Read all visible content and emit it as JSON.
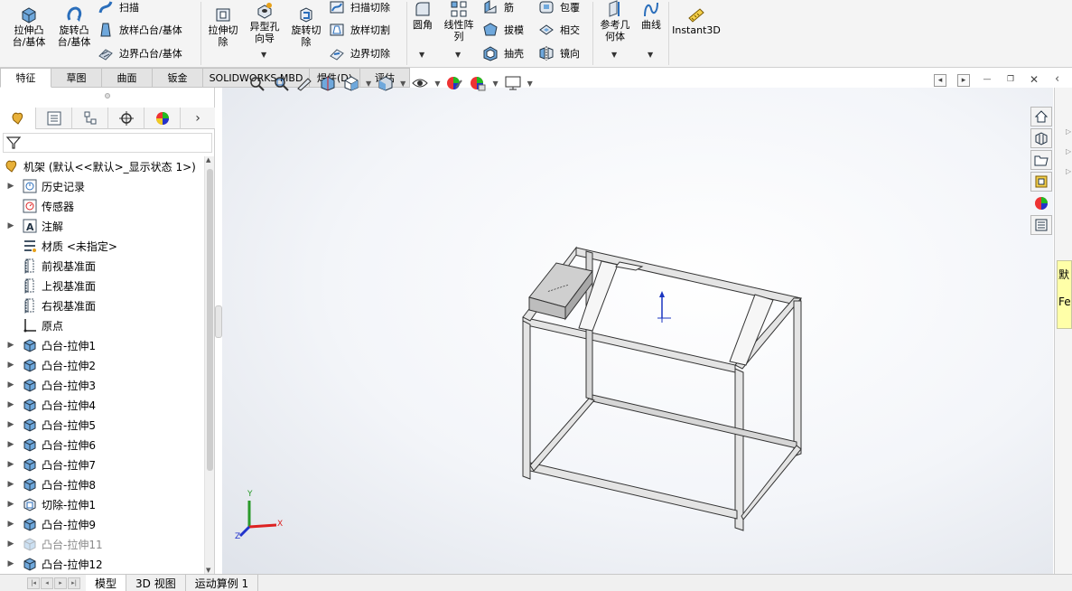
{
  "ribbon": {
    "extrude_boss": "拉伸凸\n台/基体",
    "revolve_boss": "旋转凸\n台/基体",
    "sweep": "扫描",
    "loft_boss": "放样凸台/基体",
    "boundary_boss": "边界凸台/基体",
    "extrude_cut": "拉伸切\n除",
    "hole_wizard": "异型孔\n向导",
    "revolve_cut": "旋转切\n除",
    "sweep_cut": "扫描切除",
    "loft_cut": "放样切割",
    "boundary_cut": "边界切除",
    "fillet": "圆角",
    "linear_pattern": "线性阵\n列",
    "rib": "筋",
    "draft": "拔模",
    "shell": "抽壳",
    "wrap": "包覆",
    "intersect": "相交",
    "mirror": "镜向",
    "ref_geometry": "参考几\n何体",
    "curves": "曲线",
    "instant3d": "Instant3D"
  },
  "command_tabs": [
    "特征",
    "草图",
    "曲面",
    "钣金",
    "SOLIDWORKS MBD",
    "焊件(D)",
    "评估"
  ],
  "tree": {
    "root": "机架  (默认<<默认>_显示状态 1>)",
    "items": [
      {
        "label": "历史记录",
        "expandable": true,
        "icon": "history-icon"
      },
      {
        "label": "传感器",
        "expandable": false,
        "icon": "sensor-icon"
      },
      {
        "label": "注解",
        "expandable": true,
        "icon": "annotation-icon"
      },
      {
        "label": "材质 <未指定>",
        "expandable": false,
        "icon": "material-icon"
      },
      {
        "label": "前视基准面",
        "expandable": false,
        "icon": "plane-icon"
      },
      {
        "label": "上视基准面",
        "expandable": false,
        "icon": "plane-icon"
      },
      {
        "label": "右视基准面",
        "expandable": false,
        "icon": "plane-icon"
      },
      {
        "label": "原点",
        "expandable": false,
        "icon": "origin-icon"
      },
      {
        "label": "凸台-拉伸1",
        "expandable": true,
        "icon": "boss-extrude-icon"
      },
      {
        "label": "凸台-拉伸2",
        "expandable": true,
        "icon": "boss-extrude-icon"
      },
      {
        "label": "凸台-拉伸3",
        "expandable": true,
        "icon": "boss-extrude-icon"
      },
      {
        "label": "凸台-拉伸4",
        "expandable": true,
        "icon": "boss-extrude-icon"
      },
      {
        "label": "凸台-拉伸5",
        "expandable": true,
        "icon": "boss-extrude-icon"
      },
      {
        "label": "凸台-拉伸6",
        "expandable": true,
        "icon": "boss-extrude-icon"
      },
      {
        "label": "凸台-拉伸7",
        "expandable": true,
        "icon": "boss-extrude-icon"
      },
      {
        "label": "凸台-拉伸8",
        "expandable": true,
        "icon": "boss-extrude-icon"
      },
      {
        "label": "切除-拉伸1",
        "expandable": true,
        "icon": "cut-extrude-icon"
      },
      {
        "label": "凸台-拉伸9",
        "expandable": true,
        "icon": "boss-extrude-icon"
      },
      {
        "label": "凸台-拉伸11",
        "expandable": true,
        "icon": "boss-extrude-icon",
        "suppressed": true
      },
      {
        "label": "凸台-拉伸12",
        "expandable": true,
        "icon": "boss-extrude-icon"
      }
    ]
  },
  "bottom_tabs": [
    "模型",
    "3D 视图",
    "运动算例 1"
  ],
  "triad": {
    "x": "X",
    "y": "Y",
    "z": "Z"
  },
  "right_panel_text": "默\nFe",
  "colors": {
    "accent": "#1a5fb4",
    "ribbon_bg": "#f4f4f4",
    "selected_tab": "#ffffff"
  }
}
